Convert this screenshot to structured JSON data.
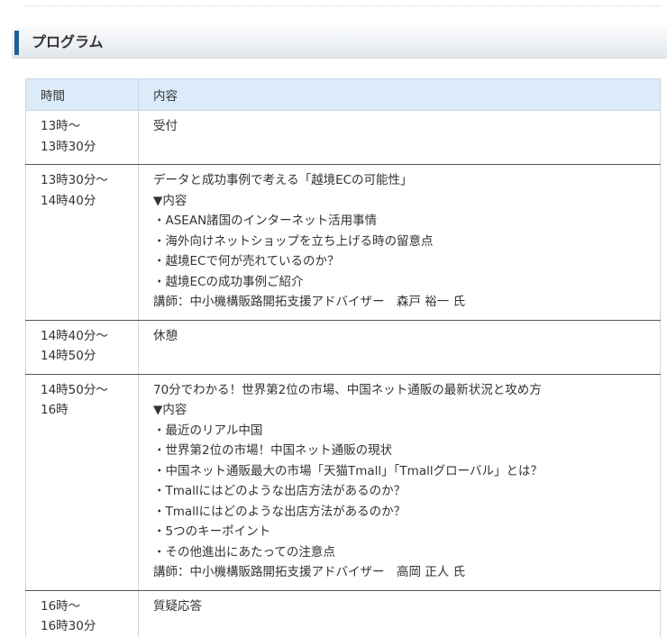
{
  "section": {
    "title": "プログラム"
  },
  "table": {
    "headers": {
      "time": "時間",
      "content": "内容"
    },
    "rows": [
      {
        "time": [
          "13時～",
          "13時30分"
        ],
        "content": [
          "受付"
        ]
      },
      {
        "time": [
          "13時30分～",
          "14時40分"
        ],
        "content": [
          "データと成功事例で考える「越境ECの可能性」",
          "▼内容",
          "・ASEAN諸国のインターネット活用事情",
          "・海外向けネットショップを立ち上げる時の留意点",
          "・越境ECで何が売れているのか？",
          "・越境ECの成功事例ご紹介",
          "講師：中小機構販路開拓支援アドバイザー　森戸 裕一 氏"
        ]
      },
      {
        "time": [
          "14時40分～",
          "14時50分"
        ],
        "content": [
          "休憩"
        ]
      },
      {
        "time": [
          "14時50分～",
          "16時"
        ],
        "content": [
          "70分でわかる！世界第2位の市場、中国ネット通販の最新状況と攻め方",
          "▼内容",
          "・最近のリアル中国",
          "・世界第2位の市場！中国ネット通販の現状",
          "・中国ネット通販最大の市場「天猫Tmall」「Tmallグローバル」とは？",
          "・Tmallにはどのような出店方法があるのか？",
          "・Tmallにはどのような出店方法があるのか？",
          "・5つのキーポイント",
          "・その他進出にあたっての注意点",
          "講師：中小機構販路開拓支援アドバイザー　高岡 正人 氏"
        ]
      },
      {
        "time": [
          "16時～",
          "16時30分"
        ],
        "content": [
          "質疑応答"
        ]
      }
    ]
  }
}
